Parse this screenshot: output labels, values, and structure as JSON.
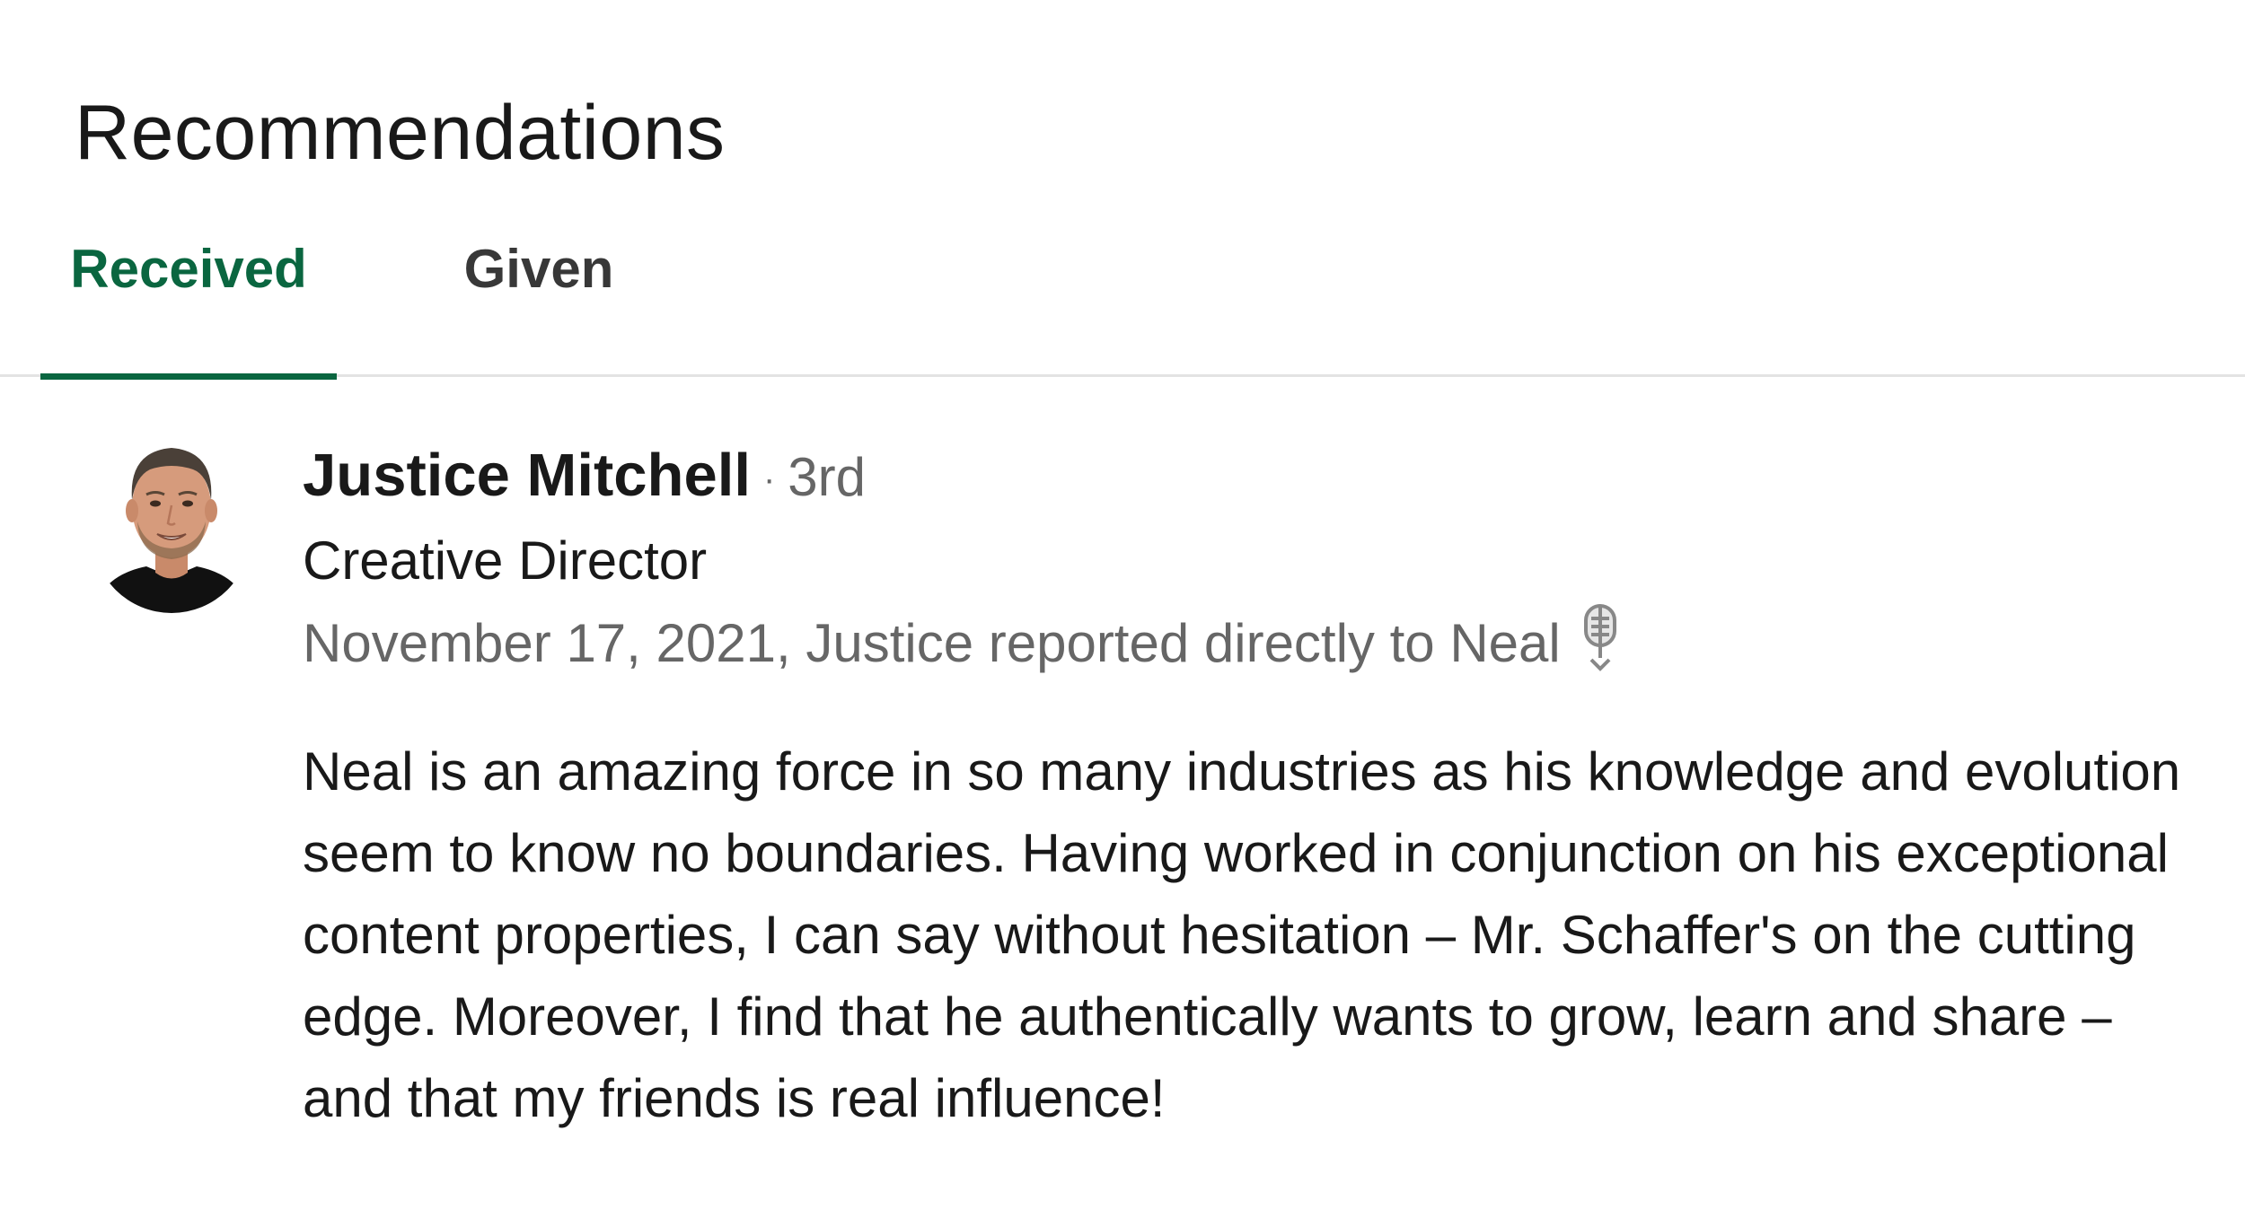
{
  "section": {
    "heading": "Recommendations"
  },
  "tabs": [
    {
      "label": "Received",
      "active": true
    },
    {
      "label": "Given",
      "active": false
    }
  ],
  "recommendation": {
    "name": "Justice Mitchell",
    "degree_separator": "·",
    "degree": "3rd",
    "title": "Creative Director",
    "meta": "November 17, 2021, Justice reported directly to Neal",
    "icon": "microphone-icon",
    "text": "Neal is an amazing force in so many industries as his knowledge and evolution seem to know no boundaries. Having worked in conjunction on his exceptional content properties, I can say without hesitation – Mr. Schaffer's on the cutting edge. Moreover, I find that he authentically wants to grow, learn and share – and that my friends is real influence!"
  },
  "colors": {
    "accent": "#0a6640",
    "text_primary": "#191919",
    "text_secondary": "#666666",
    "divider": "#e3e3e3"
  }
}
